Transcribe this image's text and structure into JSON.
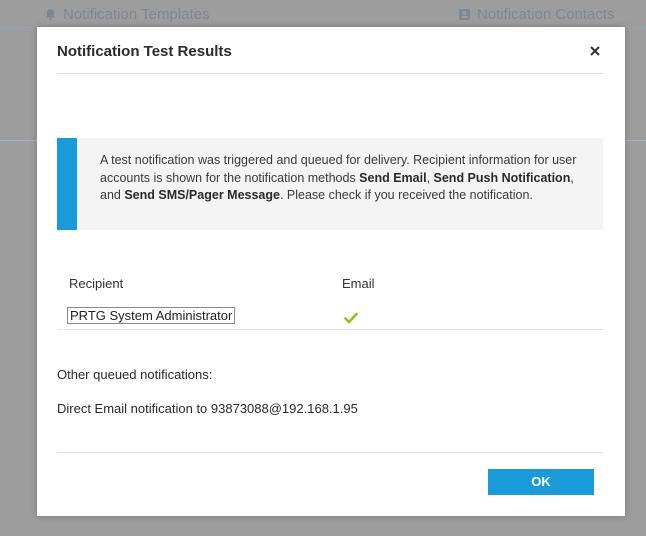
{
  "background": {
    "tab_left_label": "Notification Templates",
    "tab_right_label": "Notification Contacts"
  },
  "dialog": {
    "title": "Notification Test Results",
    "close_label": "×",
    "info": {
      "text_1": "A test notification was triggered and queued for delivery. Recipient information for user accounts is shown for the notification methods ",
      "method_1": "Send Email",
      "sep_1": ", ",
      "method_2": "Send Push Notification",
      "sep_2": ", and ",
      "method_3": "Send SMS/Pager Message",
      "text_2": ". Please check if you received the notification."
    },
    "table": {
      "headers": [
        "Recipient",
        "Email"
      ],
      "rows": [
        {
          "recipient": "PRTG System Administrator",
          "email_status": "check-icon"
        }
      ]
    },
    "other": {
      "label": "Other queued notifications:",
      "items": [
        "Direct Email notification to 93873088@192.168.1.95"
      ]
    },
    "ok_label": "OK"
  },
  "colors": {
    "accent": "#1a9ad9",
    "check": "#8dc21f",
    "info_bg": "#f4f4f4",
    "overlay": "#9d9d9d"
  }
}
